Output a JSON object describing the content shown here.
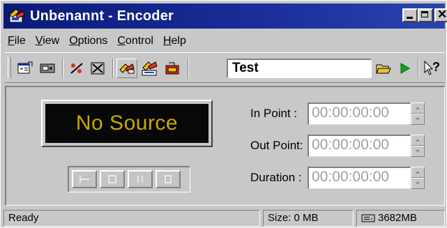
{
  "window": {
    "title": "Unbenannt - Encoder",
    "close_glyph": "✕"
  },
  "menu": {
    "items": [
      {
        "first": "F",
        "rest": "ile"
      },
      {
        "first": "V",
        "rest": "iew"
      },
      {
        "first": "O",
        "rest": "ptions"
      },
      {
        "first": "C",
        "rest": "ontrol"
      },
      {
        "first": "H",
        "rest": "elp"
      }
    ]
  },
  "toolbar": {
    "icons": [
      "properties-icon",
      "video-input-icon",
      "no-audio-icon",
      "no-video-icon",
      "encode-icon",
      "streaming-icon",
      "file-output-icon",
      "open-folder-icon",
      "play-icon",
      "context-help-icon"
    ],
    "session_name": "Test",
    "help_glyph": "?"
  },
  "display": {
    "source_text": "No Source",
    "text_color": "#c8a800"
  },
  "timecode": {
    "in_point": {
      "label": "In Point :",
      "value": "00:00:00:00"
    },
    "out_point": {
      "label": "Out Point:",
      "value": "00:00:00:00"
    },
    "duration": {
      "label": "Duration :",
      "value": "00:00:00:00"
    }
  },
  "status": {
    "state": "Ready",
    "size": "Size: 0 MB",
    "disk_free": "3682MB"
  },
  "colors": {
    "titlebar": "#0a1a7a",
    "face": "#c8c8c8",
    "play_green": "#10a020"
  }
}
